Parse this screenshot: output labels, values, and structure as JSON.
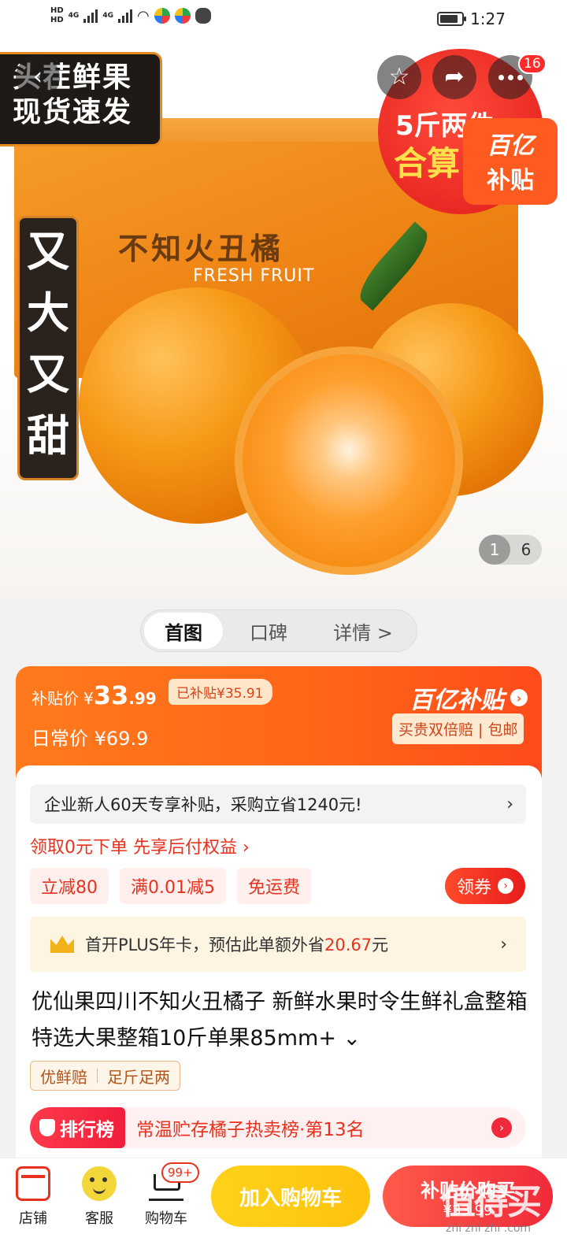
{
  "status_bar": {
    "hd1": "HD",
    "hd2": "HD",
    "net1": "4G",
    "net2": "4G",
    "battery_fraction": 0.85,
    "time": "1:27"
  },
  "hero": {
    "badge_topleft_line1": "头茬鲜果",
    "badge_topleft_line2": "现货速发",
    "box_name": "不知火丑橘",
    "box_subtitle": "FRESH FRUIT",
    "vertical_badge": [
      "又",
      "大",
      "又",
      "甜"
    ],
    "promo_line1": "5斤两件",
    "promo_line2": "合算",
    "subsidy_tag_line1": "百亿",
    "subsidy_tag_line2": "补贴",
    "notification_count": "16",
    "pager_current": "1",
    "pager_total": "6"
  },
  "tabs": [
    {
      "label": "首图"
    },
    {
      "label": "口碑"
    },
    {
      "label": "详情 >"
    }
  ],
  "price": {
    "subsidy_label": "补贴价",
    "currency": "¥",
    "subsidy_price_int": "33",
    "subsidy_price_dec": ".99",
    "subsidized_amount": "已补贴¥35.91",
    "daily_label": "日常价",
    "daily_price": "¥69.9",
    "brand": "百亿补贴",
    "guarantee": "买贵双倍赔 | 包邮"
  },
  "offers": {
    "enterprise_text": "企业新人60天专享补贴，采购立省1240元!",
    "paylater": "领取0元下单 先享后付权益 ›",
    "coupons": [
      "立减80",
      "满0.01减5",
      "免运费"
    ],
    "claim_button": "领券",
    "plus_prefix": "首开PLUS年卡，预估此单额外省",
    "plus_amount": "20.67",
    "plus_suffix": "元"
  },
  "product": {
    "title": "优仙果四川不知火丑橘子 新鲜水果时令生鲜礼盒整箱 特选大果整箱10斤单果85mm+ ⌄",
    "feature_tags": [
      "优鲜赔",
      "足斤足两"
    ],
    "rank_badge": "排行榜",
    "rank_text": "常温贮存橘子热卖榜·第13名"
  },
  "bottom_bar": {
    "store": "店铺",
    "service": "客服",
    "cart": "购物车",
    "cart_badge": "99+",
    "add_to_cart": "加入购物车",
    "buy_now_line1": "补贴价购买",
    "buy_now_line2": "¥33.99",
    "watermark": "值得买",
    "watermark_sub": "zhi zhi zhi .com"
  }
}
